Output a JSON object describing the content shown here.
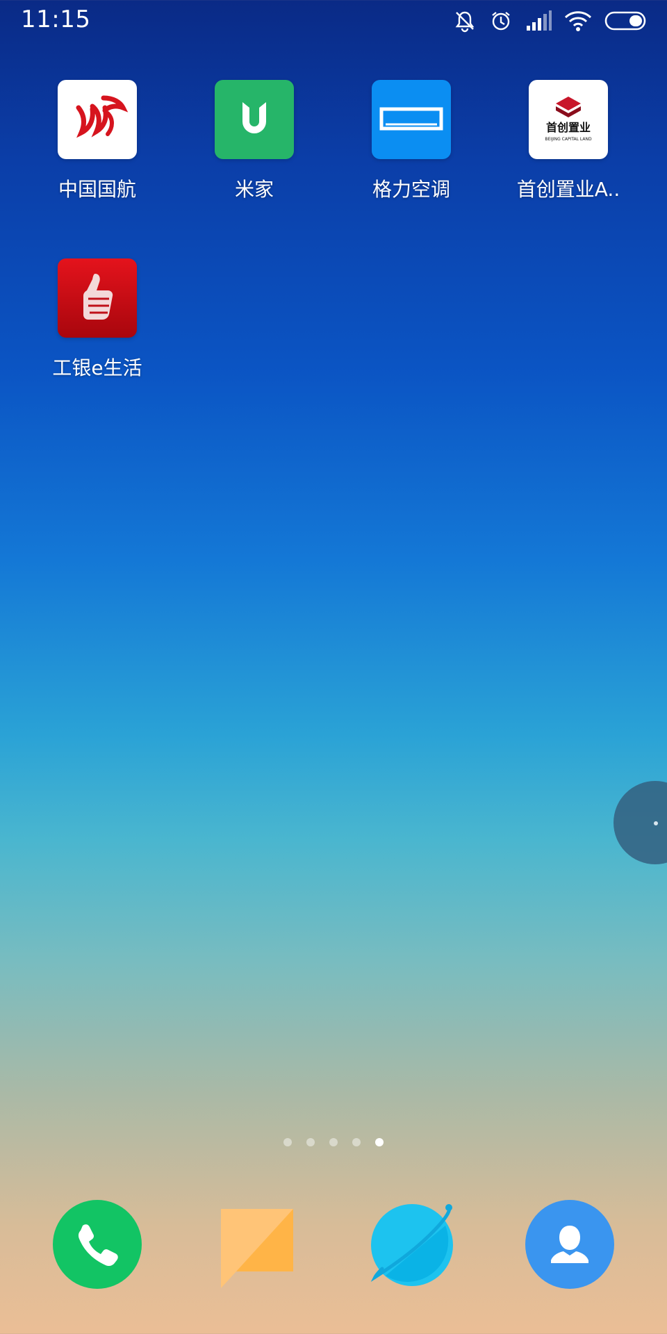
{
  "status_bar": {
    "time": "11:15",
    "icons": [
      "mute-icon",
      "alarm-icon",
      "signal-icon",
      "wifi-icon",
      "battery-icon"
    ]
  },
  "home_apps": [
    {
      "label": "中国国航",
      "icon": "air-china-icon"
    },
    {
      "label": "米家",
      "icon": "mijia-icon"
    },
    {
      "label": "格力空调",
      "icon": "gree-ac-icon"
    },
    {
      "label": "首创置业A..",
      "icon": "capital-land-icon",
      "logo_text_cn": "首创置业",
      "logo_text_en": "BEIJING CAPITAL LAND"
    },
    {
      "label": "工银e生活",
      "icon": "icbc-thumbs-up-icon"
    }
  ],
  "page_indicator": {
    "total": 5,
    "active": 5
  },
  "dock": [
    {
      "name": "phone",
      "icon": "phone-icon",
      "color": "#12c464"
    },
    {
      "name": "messages",
      "icon": "messages-icon",
      "color": "#ffb74d"
    },
    {
      "name": "browser",
      "icon": "browser-icon",
      "color": "#1dc3ef"
    },
    {
      "name": "contacts",
      "icon": "contacts-icon",
      "color": "#3a95ef"
    }
  ],
  "floating_ball": {
    "icon": "floating-ball-icon"
  }
}
